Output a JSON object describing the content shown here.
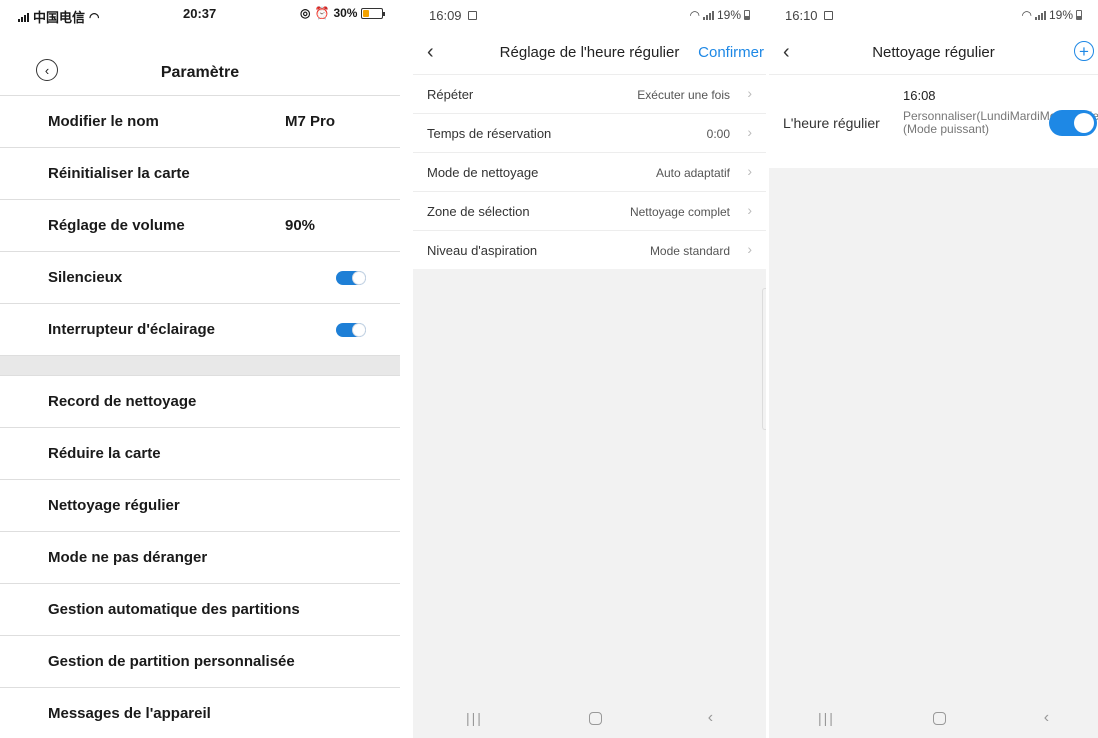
{
  "panel1": {
    "status": {
      "carrier": "中国电信",
      "time": "20:37",
      "battery": "30%"
    },
    "title": "Paramètre",
    "rows": [
      {
        "label": "Modifier le nom",
        "value": "M7 Pro"
      },
      {
        "label": "Réinitialiser la carte",
        "value": ""
      },
      {
        "label": "Réglage de volume",
        "value": "90%"
      },
      {
        "label": "Silencieux",
        "toggle": true
      },
      {
        "label": "Interrupteur d'éclairage",
        "toggle": true
      }
    ],
    "rows2": [
      {
        "label": "Record de nettoyage"
      },
      {
        "label": "Réduire la carte"
      },
      {
        "label": "Nettoyage régulier"
      },
      {
        "label": "Mode ne pas déranger"
      },
      {
        "label": "Gestion automatique des partitions"
      },
      {
        "label": "Gestion de partition personnalisée"
      },
      {
        "label": "Messages de l'appareil"
      }
    ],
    "accent": "#1e7fd6"
  },
  "panel2": {
    "status": {
      "time": "16:09",
      "battery": "19%"
    },
    "title": "Réglage de l'heure régulier",
    "confirm": "Confirmer",
    "rows": [
      {
        "label": "Répéter",
        "value": "Exécuter une fois"
      },
      {
        "label": "Temps de réservation",
        "value": "0:00"
      },
      {
        "label": "Mode de nettoyage",
        "value": "Auto adaptatif"
      },
      {
        "label": "Zone de sélection",
        "value": "Nettoyage complet"
      },
      {
        "label": "Niveau d'aspiration",
        "value": "Mode standard"
      }
    ],
    "accent": "#1e88e5"
  },
  "panel3": {
    "status": {
      "time": "16:10",
      "battery": "19%"
    },
    "title": "Nettoyage régulier",
    "task": {
      "time": "16:08",
      "label": "L'heure régulier",
      "description": "Personnaliser(LundiMardiMercrediJeudiVendredi)(Mode puissant)",
      "enabled": true
    }
  },
  "icons": {
    "back": "chevron-left-icon",
    "back_circle": "back-circle-icon",
    "arrow": "chevron-right-icon",
    "add": "plus-circle-icon",
    "wifi": "wifi-icon",
    "signal": "signal-icon",
    "battery": "battery-icon"
  }
}
